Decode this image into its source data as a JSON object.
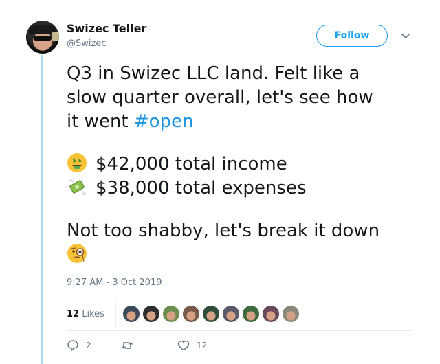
{
  "author": {
    "display_name": "Swizec Teller",
    "handle": "@Swizec"
  },
  "follow_button": {
    "label": "Follow"
  },
  "tweet": {
    "line1": "Q3 in Swizec LLC land. Felt like a",
    "line2": "slow quarter overall, let's see how",
    "line3_text": "it went ",
    "hashtag": "#open",
    "income": "$42,000 total income",
    "expenses": "$38,000 total expenses",
    "closing": "Not too shabby, let's break it down",
    "emojis": [
      "money-mouth-face",
      "money-with-wings",
      "face-with-monocle"
    ]
  },
  "timestamp": "9:27 AM - 3 Oct 2019",
  "likes": {
    "count": "12",
    "label": "Likes",
    "avatars": [
      "#3b4a5a",
      "#2e2e2e",
      "#6b8e4e",
      "#7a5a4a",
      "#2f4f3a",
      "#5a5a6a",
      "#3d6b3d",
      "#6a4a5a",
      "#8a8a7a"
    ]
  },
  "actions": {
    "reply_count": "2",
    "retweet_count": "",
    "like_count": "12"
  },
  "colors": {
    "accent": "#1da1f2",
    "hashtag": "#1b95e0",
    "thread_line": "#a6d9f2",
    "muted": "#657786"
  }
}
